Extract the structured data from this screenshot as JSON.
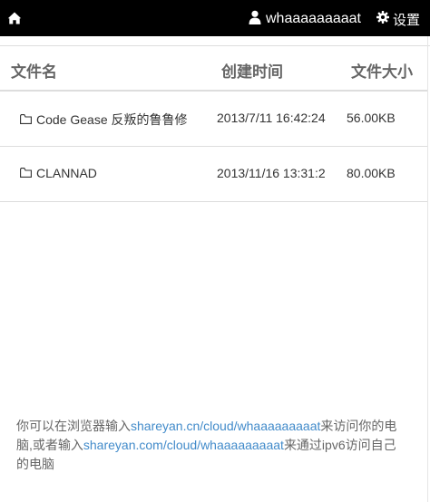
{
  "navbar": {
    "home_icon": "home-icon",
    "user_icon": "user-icon",
    "username": "whaaaaaaaaat",
    "settings_icon": "gear-icon",
    "settings_label": "设置"
  },
  "table": {
    "headers": {
      "name": "文件名",
      "created": "创建时间",
      "size": "文件大小"
    },
    "rows": [
      {
        "icon": "folder-icon",
        "name": "Code Gease 反叛的鲁鲁修",
        "created": "2013/7/11 16:42:24",
        "size": "56.00KB"
      },
      {
        "icon": "folder-icon",
        "name": "CLANNAD",
        "created": "2013/11/16 13:31:2",
        "size": "80.00KB"
      }
    ]
  },
  "footer": {
    "text_1": "你可以在浏览器输入",
    "link_1": "shareyan.cn/cloud/whaaaaaaaaat",
    "text_2": "来访问你的电脑,或者输入",
    "link_2": "shareyan.com/cloud/whaaaaaaaaat",
    "text_3": "来通过ipv6访问自己的电脑"
  },
  "colors": {
    "navbar_bg": "#000000",
    "link": "#428bca"
  }
}
